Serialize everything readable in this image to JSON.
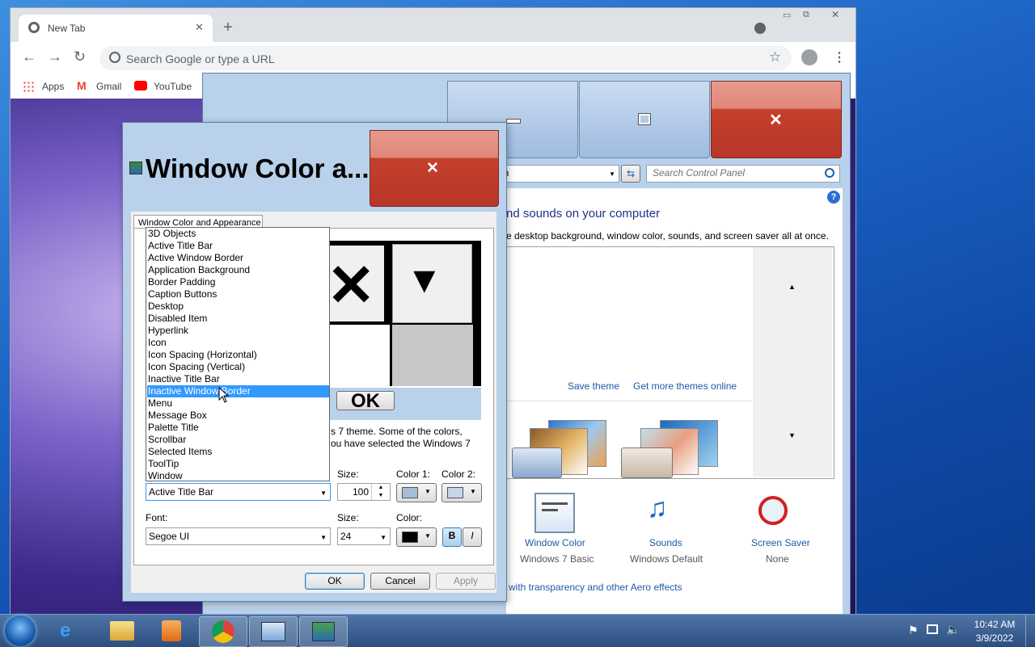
{
  "chrome": {
    "tab_title": "New Tab",
    "omnibox_placeholder": "Search Google or type a URL",
    "bookmarks": [
      "Apps",
      "Gmail",
      "YouTube"
    ]
  },
  "control_panel": {
    "address_fragment": "on",
    "search_placeholder": "Search Control Panel",
    "heading_fragment": "nd sounds on your computer",
    "subheading_fragment": "e desktop background, window color, sounds, and screen saver all at once.",
    "save_theme": "Save theme",
    "get_more_themes": "Get more themes online",
    "items": [
      {
        "label": "Window Color",
        "value": "Windows 7 Basic"
      },
      {
        "label": "Sounds",
        "value": "Windows Default"
      },
      {
        "label": "Screen Saver",
        "value": "None"
      }
    ],
    "aero_link_fragment": "with transparency and other Aero effects"
  },
  "dialog": {
    "title": "Window Color a...",
    "tab_label": "Window Color and Appearance",
    "preview_ok": "OK",
    "description_line1": "s 7 theme.  Some of the colors,",
    "description_line2": "ou have selected the Windows 7",
    "item_combo_value": "Active Title Bar",
    "item_list": [
      "3D Objects",
      "Active Title Bar",
      "Active Window Border",
      "Application Background",
      "Border Padding",
      "Caption Buttons",
      "Desktop",
      "Disabled Item",
      "Hyperlink",
      "Icon",
      "Icon Spacing (Horizontal)",
      "Icon Spacing (Vertical)",
      "Inactive Title Bar",
      "Inactive Window Border",
      "Menu",
      "Message Box",
      "Palette Title",
      "Scrollbar",
      "Selected Items",
      "ToolTip",
      "Window"
    ],
    "selected_index": 13,
    "size_label": "Size:",
    "size_value": "100",
    "color1_label": "Color 1:",
    "color2_label": "Color 2:",
    "font_label": "Font:",
    "font_value": "Segoe UI",
    "font_size_label": "Size:",
    "font_size_value": "24",
    "font_color_label": "Color:",
    "bold_label": "B",
    "italic_label": "I",
    "ok": "OK",
    "cancel": "Cancel",
    "apply": "Apply"
  },
  "taskbar": {
    "time": "10:42 AM",
    "date": "3/9/2022"
  }
}
